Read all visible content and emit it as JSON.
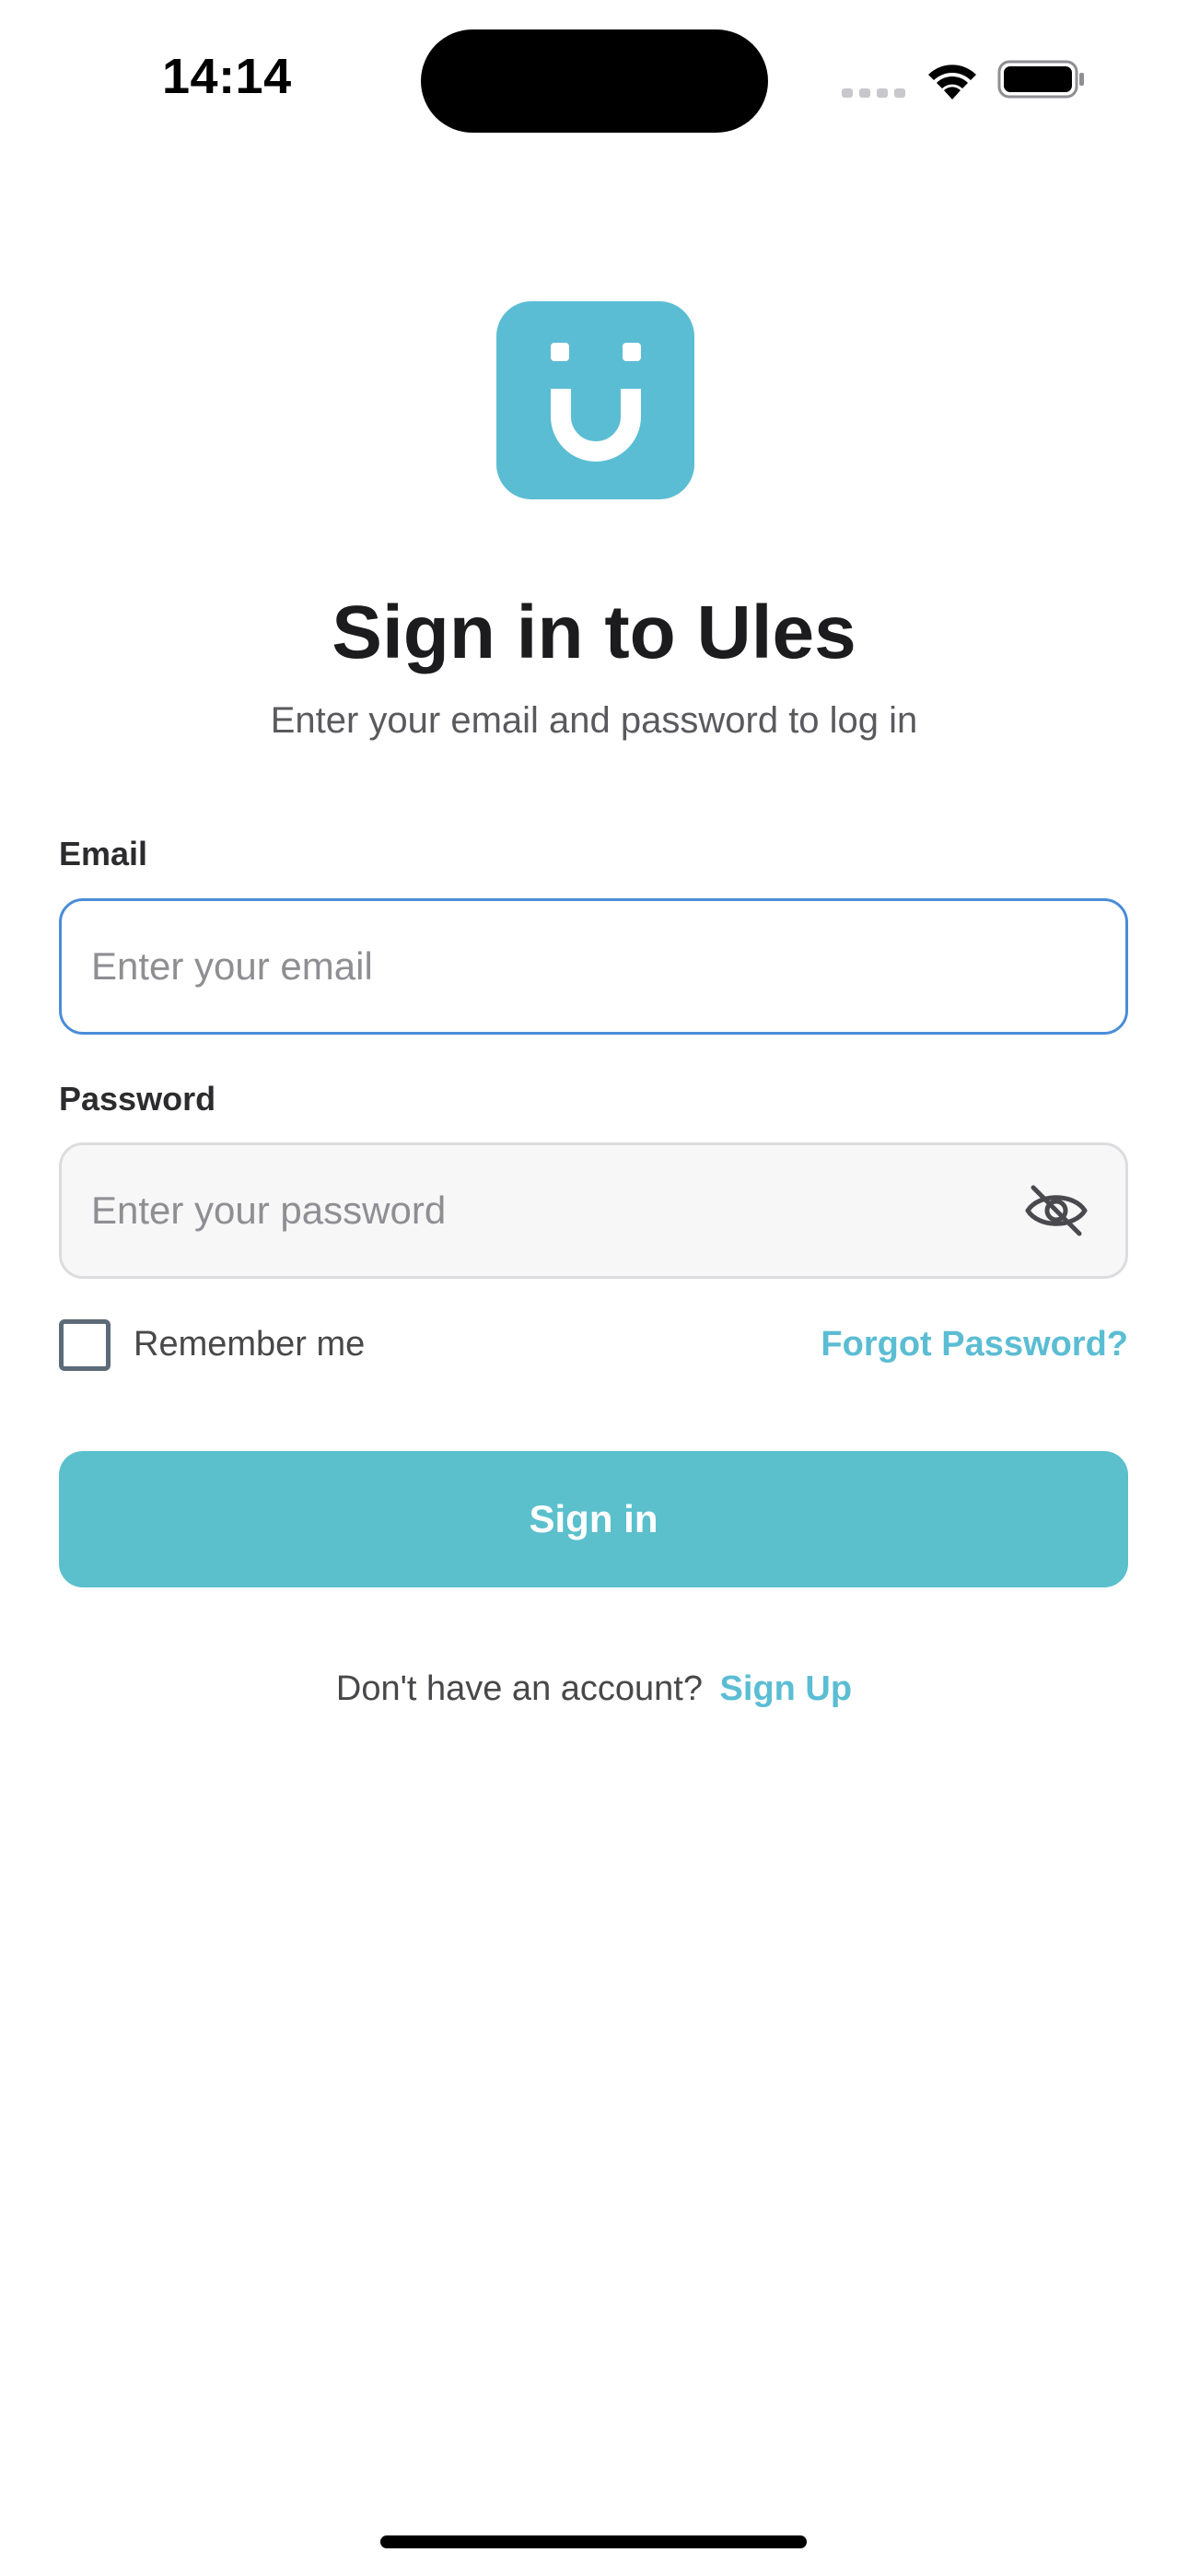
{
  "status_bar": {
    "time": "14:14"
  },
  "brand": {
    "logo_icon": "smile-u-logo",
    "accent_color": "#5bbdd3"
  },
  "header": {
    "title": "Sign in to Ules",
    "subtitle": "Enter your email and password to log in"
  },
  "form": {
    "email": {
      "label": "Email",
      "placeholder": "Enter your email",
      "value": ""
    },
    "password": {
      "label": "Password",
      "placeholder": "Enter your password",
      "value": "",
      "toggle_icon": "eye-off-icon"
    },
    "remember_me": {
      "label": "Remember me",
      "checked": false
    },
    "forgot_password": "Forgot Password?",
    "submit_label": "Sign in"
  },
  "footer": {
    "prompt": "Don't have an account?",
    "signup_label": "Sign Up"
  }
}
